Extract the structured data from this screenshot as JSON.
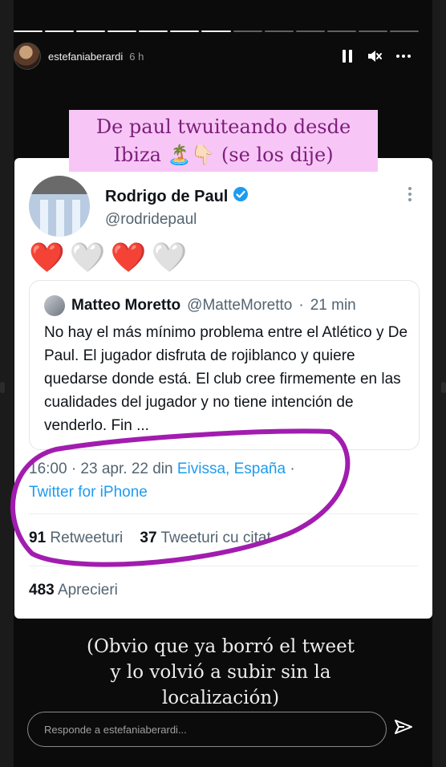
{
  "story": {
    "username": "estefaniaberardi",
    "time": "6 h",
    "progress": {
      "segments": 13,
      "completed": 7
    },
    "icons": [
      "pause-icon",
      "mute-icon",
      "more-icon"
    ],
    "caption_top_line1": "De paul twuiteando desde",
    "caption_top_line2": "Ibiza 🏝️👇🏻 (se los dije)",
    "caption_bottom_line1": "(Obvio que ya borró el tweet",
    "caption_bottom_line2": "y lo volvió a subir sin la",
    "caption_bottom_line3": "localización)",
    "reply_placeholder": "Responde a estefaniaberardi..."
  },
  "tweet": {
    "name": "Rodrigo de Paul",
    "handle": "@rodridepaul",
    "hearts": [
      "❤️",
      "🤍",
      "❤️",
      "🤍"
    ],
    "quote": {
      "name": "Matteo Moretto",
      "handle": "@MatteMoretto",
      "sep": "·",
      "time": "21 min",
      "text": "No hay el más mínimo problema entre el Atlético y De Paul. El jugador disfruta de rojiblanco y quiere quedarse donde está. El club cree firmemente en las cualidades del jugador y no tiene intención de venderlo. Fin ..."
    },
    "time_date": "16:00 · 23 apr. 22 din",
    "location": "Eivissa, España",
    "dot": "·",
    "source": "Twitter for iPhone",
    "retweets_count": "91",
    "retweets_label": "Retweeturi",
    "quotes_count": "37",
    "quotes_label": "Tweeturi cu citat",
    "likes_count": "483",
    "likes_label": "Aprecieri"
  },
  "colors": {
    "caption_bg": "#f7c6f6",
    "caption_text": "#7c1e7b",
    "annotation_oval": "#a21caf",
    "twitter_blue": "#1d9bf0",
    "heart_red": "#e0202a"
  }
}
